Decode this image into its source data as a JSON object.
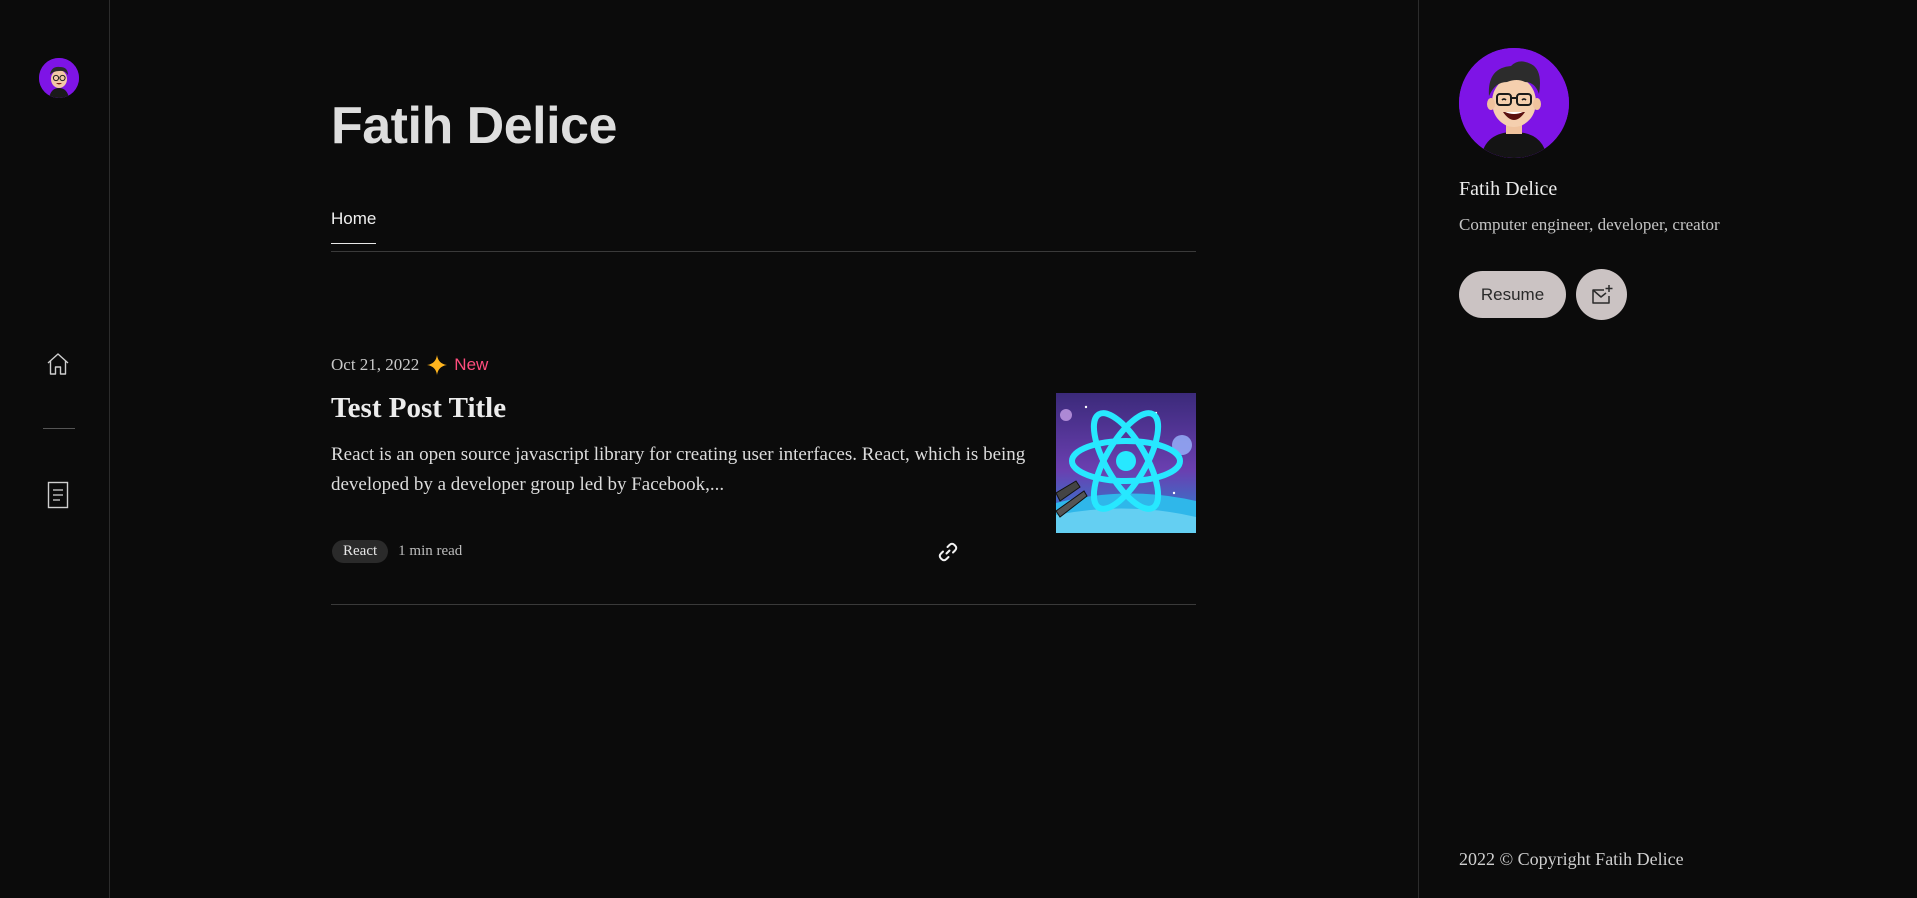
{
  "left_rail": {
    "avatar_alt": "avatar",
    "items": [
      {
        "name": "home",
        "icon": "home-icon"
      },
      {
        "name": "posts",
        "icon": "document-icon"
      }
    ]
  },
  "main": {
    "site_title": "Fatih Delice",
    "tabs": [
      {
        "label": "Home",
        "active": true
      }
    ],
    "posts": [
      {
        "date": "Oct 21, 2022",
        "badge": "New",
        "badge_color": "#ff4d7d",
        "title": "Test Post Title",
        "excerpt": "React is an open source javascript library for creating user interfaces. React, which is being developed by a developer group led by Facebook,...",
        "tag": "React",
        "read_time": "1 min read",
        "thumbnail_icon": "react-logo-icon"
      }
    ]
  },
  "profile": {
    "name": "Fatih Delice",
    "bio": "Computer engineer, developer, creator",
    "resume_label": "Resume",
    "mail_icon": "mail-plus-icon",
    "avatar_bg": "#7e14e6"
  },
  "footer": {
    "copyright": "2022 © Copyright Fatih Delice"
  },
  "colors": {
    "background": "#0b0b0b",
    "border": "#2c2c2c",
    "button_bg": "#cbc3c3",
    "sparkle": "#ffb51e"
  }
}
